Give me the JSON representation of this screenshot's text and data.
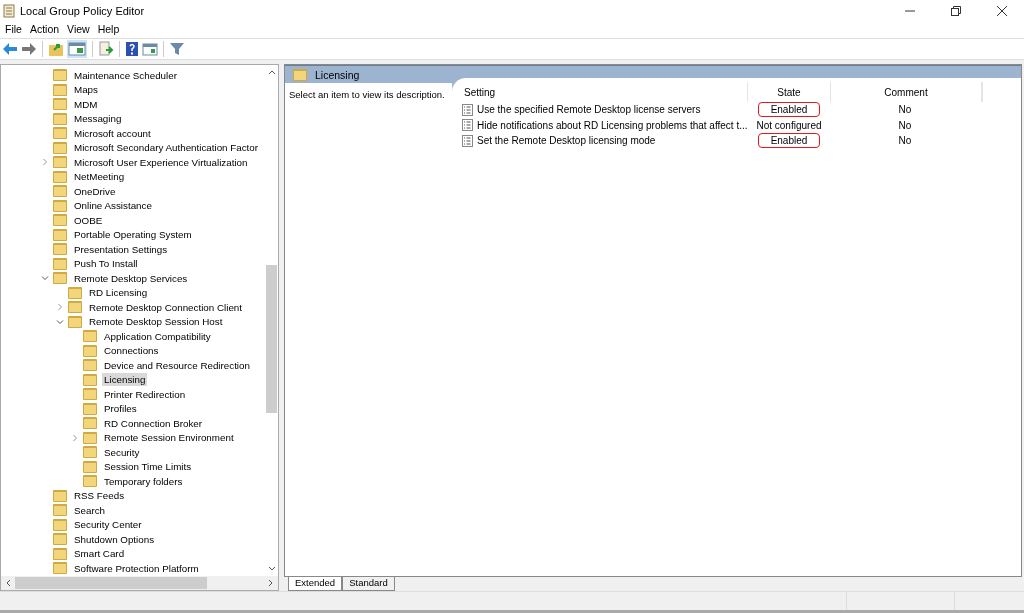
{
  "window": {
    "title": "Local Group Policy Editor"
  },
  "menu": [
    "File",
    "Action",
    "View",
    "Help"
  ],
  "tree": [
    {
      "label": "Maintenance Scheduler",
      "selected": false
    },
    {
      "label": "Maps",
      "selected": false
    },
    {
      "label": "MDM",
      "selected": false
    },
    {
      "label": "Messaging",
      "selected": false
    },
    {
      "label": "Microsoft account",
      "selected": false
    },
    {
      "label": "Microsoft Secondary Authentication Factor",
      "selected": false
    },
    {
      "label": "Microsoft User Experience Virtualization",
      "selected": false,
      "expanded": false
    },
    {
      "label": "NetMeeting",
      "selected": false
    },
    {
      "label": "OneDrive",
      "selected": false
    },
    {
      "label": "Online Assistance",
      "selected": false
    },
    {
      "label": "OOBE",
      "selected": false
    },
    {
      "label": "Portable Operating System",
      "selected": false
    },
    {
      "label": "Presentation Settings",
      "selected": false
    },
    {
      "label": "Push To Install",
      "selected": false
    },
    {
      "label": "Remote Desktop Services",
      "selected": false,
      "expanded": true,
      "children": [
        {
          "label": "RD Licensing",
          "selected": false
        },
        {
          "label": "Remote Desktop Connection Client",
          "selected": false,
          "expanded": false
        },
        {
          "label": "Remote Desktop Session Host",
          "selected": false,
          "expanded": true,
          "children": [
            {
              "label": "Application Compatibility",
              "selected": false
            },
            {
              "label": "Connections",
              "selected": false
            },
            {
              "label": "Device and Resource Redirection",
              "selected": false
            },
            {
              "label": "Licensing",
              "selected": true
            },
            {
              "label": "Printer Redirection",
              "selected": false
            },
            {
              "label": "Profiles",
              "selected": false
            },
            {
              "label": "RD Connection Broker",
              "selected": false
            },
            {
              "label": "Remote Session Environment",
              "selected": false,
              "expanded": false
            },
            {
              "label": "Security",
              "selected": false
            },
            {
              "label": "Session Time Limits",
              "selected": false
            },
            {
              "label": "Temporary folders",
              "selected": false
            }
          ]
        }
      ]
    },
    {
      "label": "RSS Feeds",
      "selected": false
    },
    {
      "label": "Search",
      "selected": false
    },
    {
      "label": "Security Center",
      "selected": false
    },
    {
      "label": "Shutdown Options",
      "selected": false
    },
    {
      "label": "Smart Card",
      "selected": false
    },
    {
      "label": "Software Protection Platform",
      "selected": false
    }
  ],
  "details": {
    "title": "Licensing",
    "description": "Select an item to view its description.",
    "columns": [
      "Setting",
      "State",
      "Comment"
    ],
    "rows": [
      {
        "setting": "Use the specified Remote Desktop license servers",
        "state": "Enabled",
        "comment": "No",
        "highlighted": true
      },
      {
        "setting": "Hide notifications about RD Licensing problems that affect t...",
        "state": "Not configured",
        "comment": "No",
        "highlighted": false
      },
      {
        "setting": "Set the Remote Desktop licensing mode",
        "state": "Enabled",
        "comment": "No",
        "highlighted": true
      }
    ]
  },
  "tabs": [
    {
      "label": "Extended",
      "selected": true
    },
    {
      "label": "Standard",
      "selected": false
    }
  ]
}
